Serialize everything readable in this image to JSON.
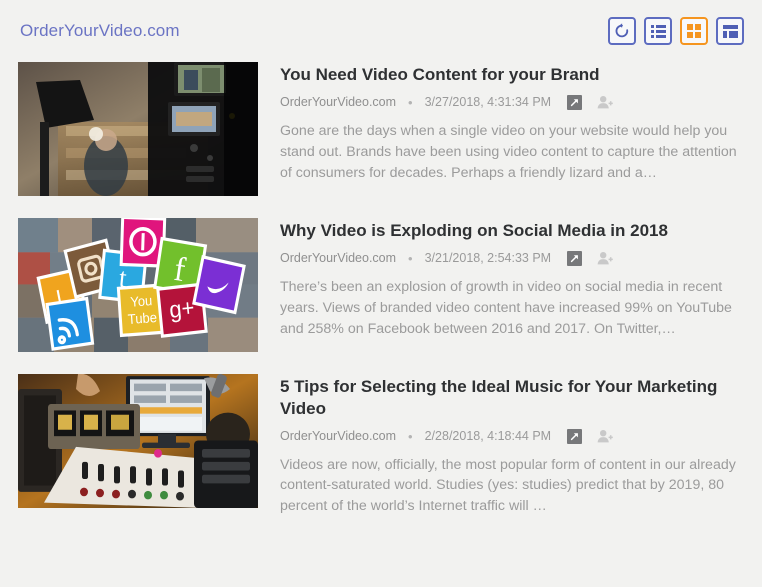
{
  "header": {
    "site_title": "OrderYourVideo.com",
    "toolbar": [
      {
        "name": "refresh-button",
        "icon": "refresh-icon",
        "label": "Refresh",
        "active": false,
        "accent": "#5d6cc0"
      },
      {
        "name": "list-view-button",
        "icon": "list-view-icon",
        "label": "List view",
        "active": false,
        "accent": "#5d6cc0"
      },
      {
        "name": "grid-view-button",
        "icon": "grid-view-icon",
        "label": "Grid view",
        "active": true,
        "accent": "#f5951f"
      },
      {
        "name": "magazine-view-button",
        "icon": "magazine-view-icon",
        "label": "Magazine view",
        "active": false,
        "accent": "#5d6cc0"
      }
    ]
  },
  "colors": {
    "page_background": "#f2f2f0",
    "link": "#6b74c4",
    "title": "#2f3133",
    "muted": "#9b9b9b",
    "accent_active": "#f5951f",
    "accent_inactive": "#5d6cc0"
  },
  "articles": [
    {
      "title": "You Need Video Content for your Brand",
      "source": "OrderYourVideo.com",
      "separator": "•",
      "date": "3/27/2018, 4:31:34 PM",
      "open_icon": "open-in-new-icon",
      "person_icon": "add-person-icon",
      "summary": "Gone are the days when a single video on your website would help you stand out. Brands have been using video content to capture the attention of consumers for decades. Perhaps a friendly lizard and a…",
      "thumbnail_alt": "video-camera-filming-in-library-thumbnail"
    },
    {
      "title": "Why Video is Exploding on Social Media in 2018",
      "source": "OrderYourVideo.com",
      "separator": "•",
      "date": "3/21/2018, 2:54:33 PM",
      "open_icon": "open-in-new-icon",
      "person_icon": "add-person-icon",
      "summary": "There’s been an explosion of growth in video on social media in recent years. Views of branded video content have increased 99% on YouTube and 258% on Facebook between 2016 and 2017. On Twitter,…",
      "thumbnail_alt": "social-media-icon-collage-thumbnail"
    },
    {
      "title": "5 Tips for Selecting the Ideal Music for Your Marketing Video",
      "source": "OrderYourVideo.com",
      "separator": "•",
      "date": "2/28/2018, 4:18:44 PM",
      "open_icon": "open-in-new-icon",
      "person_icon": "add-person-icon",
      "summary": "Videos are now, officially, the most popular form of content in our already content-saturated world. Studies (yes: studies) predict that by 2019, 80 percent of the world’s Internet traffic will …",
      "thumbnail_alt": "audio-mixing-console-studio-thumbnail"
    }
  ]
}
